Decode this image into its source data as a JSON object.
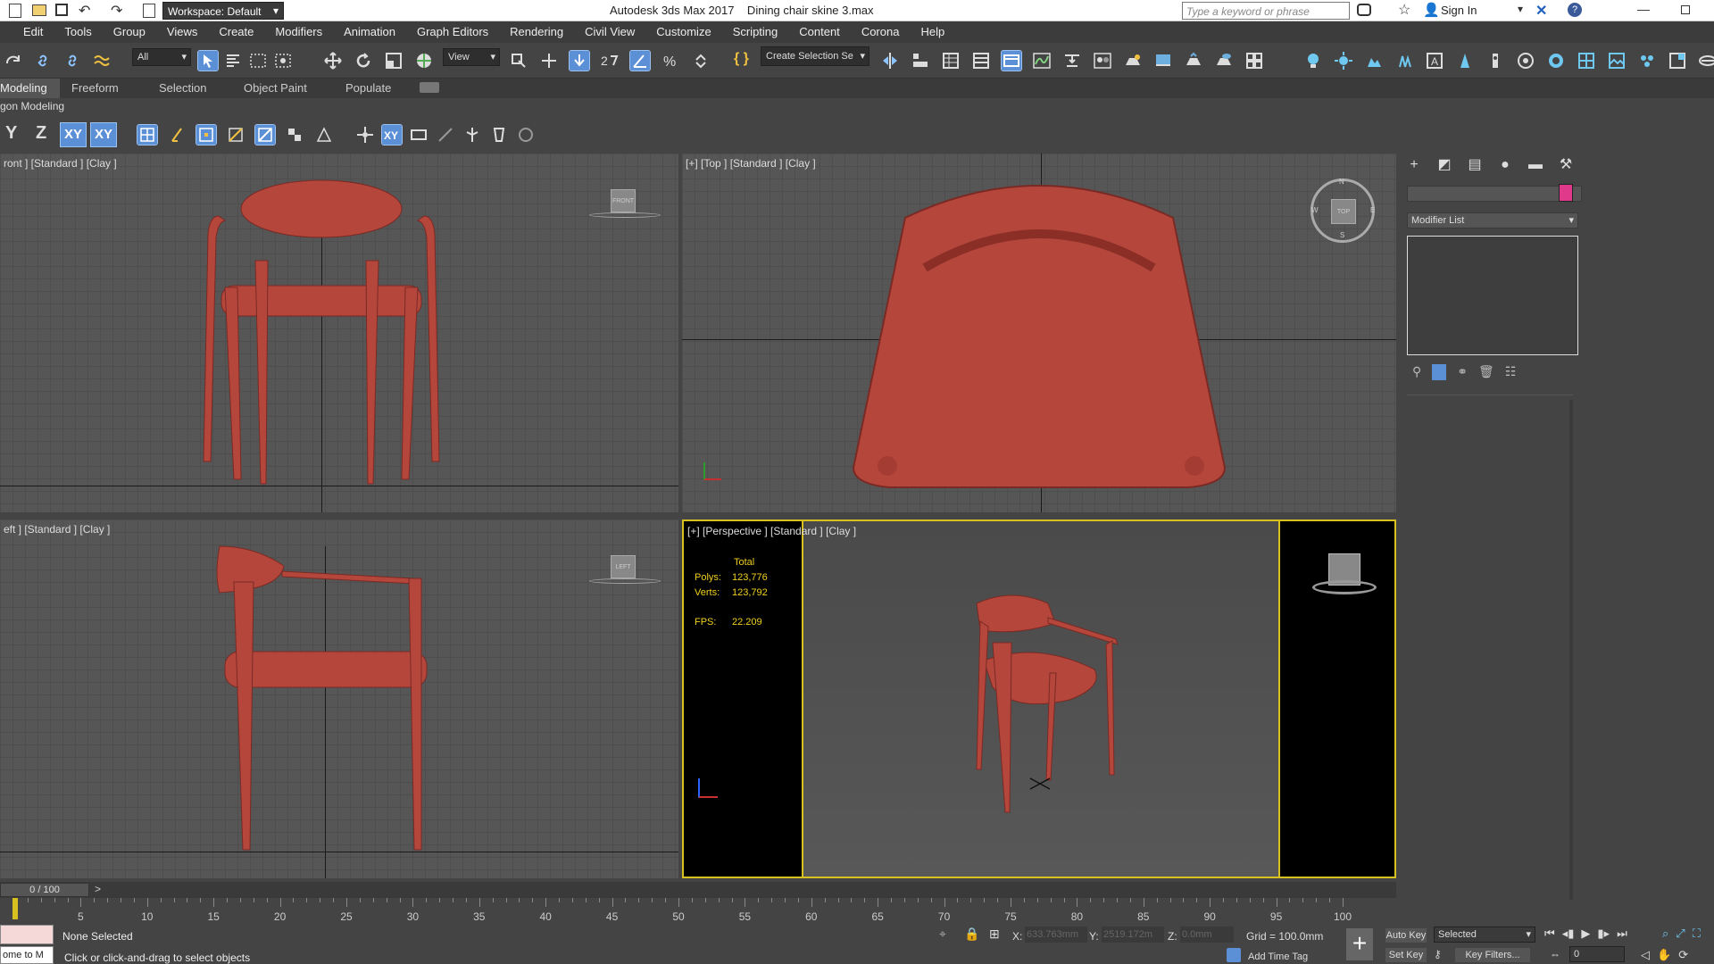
{
  "titlebar": {
    "workspace": "Workspace: Default",
    "title": "Autodesk 3ds Max 2017    Dining chair skine 3.max",
    "search_placeholder": "Type a keyword or phrase",
    "sign_in": "Sign In"
  },
  "menu": [
    "Edit",
    "Tools",
    "Group",
    "Views",
    "Create",
    "Modifiers",
    "Animation",
    "Graph Editors",
    "Rendering",
    "Civil View",
    "Customize",
    "Scripting",
    "Content",
    "Corona",
    "Help"
  ],
  "toolbar": {
    "filter_select": "All",
    "view_select": "View",
    "selection_set": "Create Selection Se"
  },
  "ribbon_tabs": [
    "Modeling",
    "Freeform",
    "Selection",
    "Object Paint",
    "Populate"
  ],
  "ribbon_subtitle": "gon Modeling",
  "axis_buttons": [
    "Y",
    "Z",
    "XY",
    "XY"
  ],
  "viewports": {
    "front": "ront ] [Standard ] [Clay ]",
    "top": "[+] [Top ] [Standard ] [Clay ]",
    "left": "eft ] [Standard ] [Clay ]",
    "perspective": "[+] [Perspective ] [Standard ] [Clay ]"
  },
  "stats": {
    "header": "Total",
    "polys_label": "Polys:",
    "polys": "123,776",
    "verts_label": "Verts:",
    "verts": "123,792",
    "fps_label": "FPS:",
    "fps": "22.209"
  },
  "viewcube": {
    "front": "FRONT",
    "top": "TOP",
    "left": "LEFT"
  },
  "compass": {
    "n": "N",
    "s": "S",
    "e": "E",
    "w": "W"
  },
  "command_panel": {
    "modifier_list": "Modifier List",
    "accent_color": "#e0388a"
  },
  "timeline": {
    "frame": "0 / 100",
    "ticks": [
      "5",
      "10",
      "15",
      "20",
      "25",
      "30",
      "35",
      "40",
      "45",
      "50",
      "55",
      "60",
      "65",
      "70",
      "75",
      "80",
      "85",
      "90",
      "95",
      "100"
    ]
  },
  "status": {
    "script_text": "ome to M",
    "none_selected": "None Selected",
    "prompt": "Click or click-and-drag to select objects",
    "x_label": "X:",
    "x": "633.763mm",
    "y_label": "Y:",
    "y": "2519.172m",
    "z_label": "Z:",
    "z": "0.0mm",
    "grid": "Grid = 100.0mm",
    "add_time_tag": "Add Time Tag",
    "auto_key": "Auto Key",
    "set_key": "Set Key",
    "selected": "Selected",
    "key_filters": "Key Filters...",
    "frame_field": "0"
  },
  "colors": {
    "chair": "#b5463c",
    "viewport_bg": "#565656",
    "active_border": "#d8c020"
  }
}
